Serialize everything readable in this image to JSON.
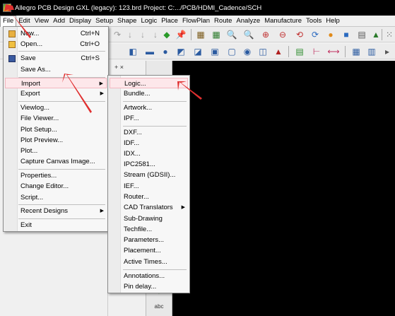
{
  "window": {
    "title": "Allegro PCB Design GXL (legacy): 123.brd  Project: C:.../PCB/HDMI_Cadence/SCH"
  },
  "menubar": {
    "items": [
      "File",
      "Edit",
      "View",
      "Add",
      "Display",
      "Setup",
      "Shape",
      "Logic",
      "Place",
      "FlowPlan",
      "Route",
      "Analyze",
      "Manufacture",
      "Tools",
      "Help"
    ]
  },
  "file_menu": {
    "new": {
      "label": "New...",
      "shortcut": "Ctrl+N"
    },
    "open": {
      "label": "Open...",
      "shortcut": "Ctrl+O"
    },
    "save": {
      "label": "Save",
      "shortcut": "Ctrl+S"
    },
    "save_as": {
      "label": "Save As..."
    },
    "import": {
      "label": "Import"
    },
    "export": {
      "label": "Export"
    },
    "viewlog": {
      "label": "Viewlog..."
    },
    "file_viewer": {
      "label": "File Viewer..."
    },
    "plot_setup": {
      "label": "Plot Setup..."
    },
    "plot_preview": {
      "label": "Plot Preview..."
    },
    "plot": {
      "label": "Plot..."
    },
    "capture_canvas": {
      "label": "Capture Canvas Image..."
    },
    "properties": {
      "label": "Properties..."
    },
    "change_editor": {
      "label": "Change Editor..."
    },
    "script": {
      "label": "Script..."
    },
    "recent_designs": {
      "label": "Recent Designs"
    },
    "exit": {
      "label": "Exit"
    }
  },
  "import_menu": {
    "logic": "Logic...",
    "bundle": "Bundle...",
    "artwork": "Artwork...",
    "ipf": "IPF...",
    "dxf": "DXF...",
    "idf": "IDF...",
    "idx": "IDX...",
    "ipc2581": "IPC2581...",
    "stream": "Stream (GDSII)...",
    "ief": "IEF...",
    "router": "Router...",
    "cad_translators": "CAD Translators",
    "sub_drawing": "Sub-Drawing",
    "techfile": "Techfile...",
    "parameters": "Parameters...",
    "placement": "Placement...",
    "active_times": "Active Times...",
    "annotations": "Annotations...",
    "pin_delay": "Pin delay..."
  },
  "panel": {
    "controls": "+ ×"
  },
  "colors": {
    "titlebar": "#000000",
    "canvas": "#000000",
    "highlight": "#fde7ea",
    "arrow": "#e03030"
  }
}
